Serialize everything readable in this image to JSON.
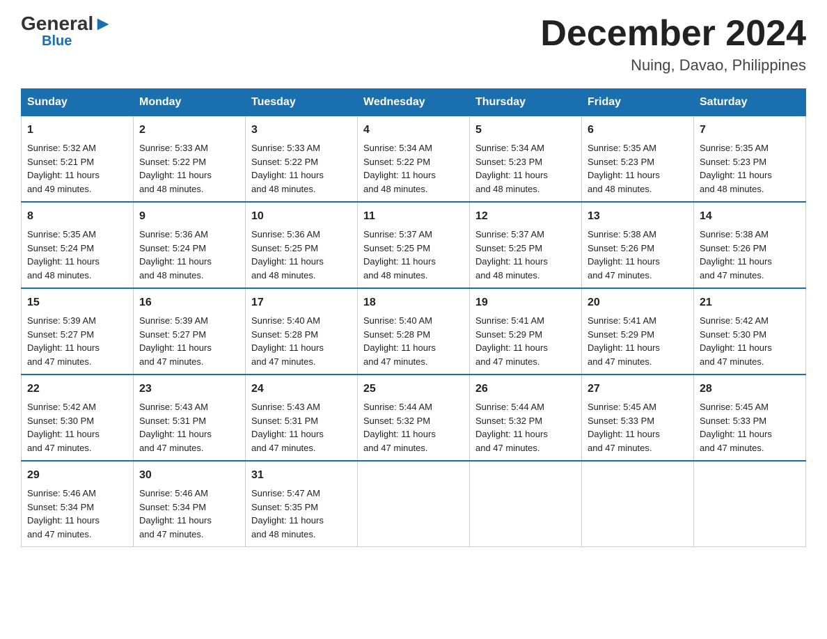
{
  "header": {
    "logo_general": "General",
    "logo_blue": "Blue",
    "month_year": "December 2024",
    "location": "Nuing, Davao, Philippines"
  },
  "days_of_week": [
    "Sunday",
    "Monday",
    "Tuesday",
    "Wednesday",
    "Thursday",
    "Friday",
    "Saturday"
  ],
  "weeks": [
    [
      {
        "day": "1",
        "sunrise": "5:32 AM",
        "sunset": "5:21 PM",
        "daylight": "11 hours and 49 minutes."
      },
      {
        "day": "2",
        "sunrise": "5:33 AM",
        "sunset": "5:22 PM",
        "daylight": "11 hours and 48 minutes."
      },
      {
        "day": "3",
        "sunrise": "5:33 AM",
        "sunset": "5:22 PM",
        "daylight": "11 hours and 48 minutes."
      },
      {
        "day": "4",
        "sunrise": "5:34 AM",
        "sunset": "5:22 PM",
        "daylight": "11 hours and 48 minutes."
      },
      {
        "day": "5",
        "sunrise": "5:34 AM",
        "sunset": "5:23 PM",
        "daylight": "11 hours and 48 minutes."
      },
      {
        "day": "6",
        "sunrise": "5:35 AM",
        "sunset": "5:23 PM",
        "daylight": "11 hours and 48 minutes."
      },
      {
        "day": "7",
        "sunrise": "5:35 AM",
        "sunset": "5:23 PM",
        "daylight": "11 hours and 48 minutes."
      }
    ],
    [
      {
        "day": "8",
        "sunrise": "5:35 AM",
        "sunset": "5:24 PM",
        "daylight": "11 hours and 48 minutes."
      },
      {
        "day": "9",
        "sunrise": "5:36 AM",
        "sunset": "5:24 PM",
        "daylight": "11 hours and 48 minutes."
      },
      {
        "day": "10",
        "sunrise": "5:36 AM",
        "sunset": "5:25 PM",
        "daylight": "11 hours and 48 minutes."
      },
      {
        "day": "11",
        "sunrise": "5:37 AM",
        "sunset": "5:25 PM",
        "daylight": "11 hours and 48 minutes."
      },
      {
        "day": "12",
        "sunrise": "5:37 AM",
        "sunset": "5:25 PM",
        "daylight": "11 hours and 48 minutes."
      },
      {
        "day": "13",
        "sunrise": "5:38 AM",
        "sunset": "5:26 PM",
        "daylight": "11 hours and 47 minutes."
      },
      {
        "day": "14",
        "sunrise": "5:38 AM",
        "sunset": "5:26 PM",
        "daylight": "11 hours and 47 minutes."
      }
    ],
    [
      {
        "day": "15",
        "sunrise": "5:39 AM",
        "sunset": "5:27 PM",
        "daylight": "11 hours and 47 minutes."
      },
      {
        "day": "16",
        "sunrise": "5:39 AM",
        "sunset": "5:27 PM",
        "daylight": "11 hours and 47 minutes."
      },
      {
        "day": "17",
        "sunrise": "5:40 AM",
        "sunset": "5:28 PM",
        "daylight": "11 hours and 47 minutes."
      },
      {
        "day": "18",
        "sunrise": "5:40 AM",
        "sunset": "5:28 PM",
        "daylight": "11 hours and 47 minutes."
      },
      {
        "day": "19",
        "sunrise": "5:41 AM",
        "sunset": "5:29 PM",
        "daylight": "11 hours and 47 minutes."
      },
      {
        "day": "20",
        "sunrise": "5:41 AM",
        "sunset": "5:29 PM",
        "daylight": "11 hours and 47 minutes."
      },
      {
        "day": "21",
        "sunrise": "5:42 AM",
        "sunset": "5:30 PM",
        "daylight": "11 hours and 47 minutes."
      }
    ],
    [
      {
        "day": "22",
        "sunrise": "5:42 AM",
        "sunset": "5:30 PM",
        "daylight": "11 hours and 47 minutes."
      },
      {
        "day": "23",
        "sunrise": "5:43 AM",
        "sunset": "5:31 PM",
        "daylight": "11 hours and 47 minutes."
      },
      {
        "day": "24",
        "sunrise": "5:43 AM",
        "sunset": "5:31 PM",
        "daylight": "11 hours and 47 minutes."
      },
      {
        "day": "25",
        "sunrise": "5:44 AM",
        "sunset": "5:32 PM",
        "daylight": "11 hours and 47 minutes."
      },
      {
        "day": "26",
        "sunrise": "5:44 AM",
        "sunset": "5:32 PM",
        "daylight": "11 hours and 47 minutes."
      },
      {
        "day": "27",
        "sunrise": "5:45 AM",
        "sunset": "5:33 PM",
        "daylight": "11 hours and 47 minutes."
      },
      {
        "day": "28",
        "sunrise": "5:45 AM",
        "sunset": "5:33 PM",
        "daylight": "11 hours and 47 minutes."
      }
    ],
    [
      {
        "day": "29",
        "sunrise": "5:46 AM",
        "sunset": "5:34 PM",
        "daylight": "11 hours and 47 minutes."
      },
      {
        "day": "30",
        "sunrise": "5:46 AM",
        "sunset": "5:34 PM",
        "daylight": "11 hours and 47 minutes."
      },
      {
        "day": "31",
        "sunrise": "5:47 AM",
        "sunset": "5:35 PM",
        "daylight": "11 hours and 48 minutes."
      },
      null,
      null,
      null,
      null
    ]
  ],
  "labels": {
    "sunrise": "Sunrise:",
    "sunset": "Sunset:",
    "daylight": "Daylight:"
  }
}
